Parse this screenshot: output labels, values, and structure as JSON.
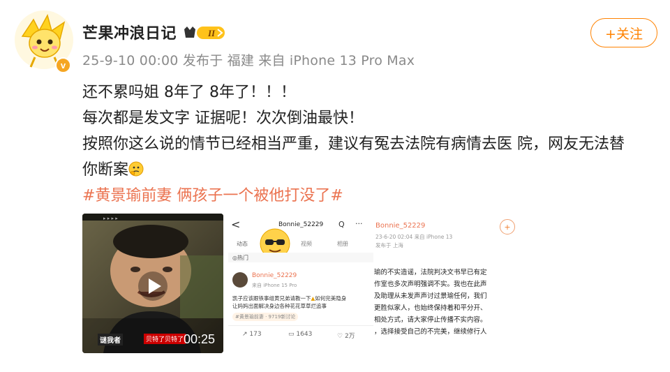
{
  "post": {
    "username": "芒果冲浪日记",
    "level_badge": "II",
    "verified_mark": "v",
    "meta": "25-9-10 00:00 发布于 福建 来自 iPhone 13 Pro Max",
    "follow_label": "+关注",
    "content_lines": [
      "还不累吗姐 8年了 8年了！！！",
      "每次都是发文字 证据呢！次次倒油最快！",
      "按照你这么说的情节已经相当严重，建议有冤去法院有病情去医 院，网友无法替",
      "你断案"
    ],
    "hashtag": "#黄景瑜前妻 俩孩子一个被他打没了#"
  },
  "video": {
    "duration": "00:25",
    "logo_text": "谜我者",
    "caption": "贝特了贝特了"
  },
  "screenshot1": {
    "back": "<",
    "title": "Bonnie_52229",
    "search_icon": "Q",
    "more": "···",
    "tab_dynamic": "动态",
    "tab_video": "视频",
    "tab_album": "相册",
    "hot": "◎热门",
    "author": "Bonnie_52229",
    "source": "来自 iPhone 15 Pro",
    "text1": "凯子应该跟铁事组黄兄弟请教一下",
    "text1b": "如何完美隐身",
    "text2": "让妈妈出面解决身边各种花花草草烂追事",
    "topic_tag": "#黄景瑜前妻 · 9719新讨论",
    "repost_count": "173",
    "comment_count": "1643",
    "like_count": "2万"
  },
  "screenshot2": {
    "author": "Bonnie_52229",
    "time": "23-6-20 02:04 来自 iPhone 13",
    "location": "发布于 上海",
    "lines": [
      "瑜的不实造谣，法院判决文书早已有定",
      "作室也多次声明强调不实。我也在此声",
      "及助理从未发声声讨过景瑜任何，我们",
      "更胜似家人，也始终保持着和平分开、",
      "相处方式，请大家停止传播不实内容。",
      "，选择接受自己的不完美，继续修行人"
    ]
  }
}
